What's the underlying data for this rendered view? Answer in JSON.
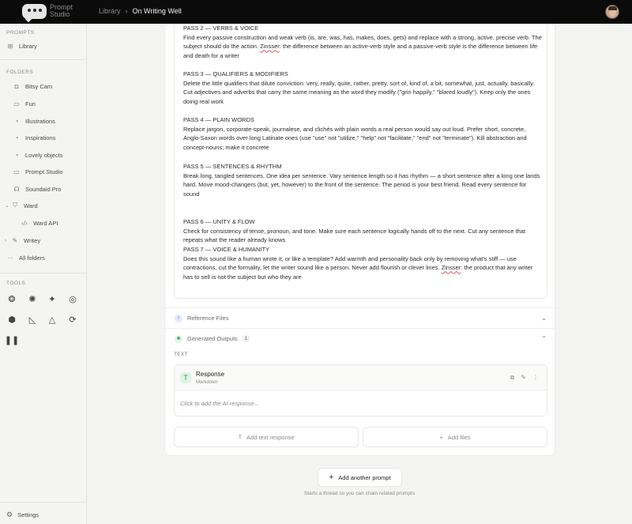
{
  "app": {
    "name_line1": "Prompt",
    "name_line2": "Studio"
  },
  "breadcrumb": {
    "root": "Library",
    "separator": "›",
    "current": "On Writing Well"
  },
  "sidebar": {
    "prompts_label": "PROMPTS",
    "library": "Library",
    "folders_label": "FOLDERS",
    "folders": [
      "Bitsy Cam",
      "Fun",
      "Illustrations",
      "Inspirations",
      "Lovely objects",
      "Prompt Studio",
      "Soundaid Pro",
      "Ward",
      "Ward API",
      "Writey",
      "All folders"
    ],
    "tools_label": "TOOLS",
    "settings": "Settings"
  },
  "prompt": {
    "passes": [
      {
        "heading": "PASS 2 — VERBS & VOICE",
        "body_pre": "Find every passive construction and weak verb (is, are, was, has, makes, does, gets) and replace with a strong, active, precise verb. The subject should do the action. ",
        "spell": "Zinsser",
        "body_post": ": the difference between an active-verb style and a passive-verb style is the difference between life and death for a writer"
      },
      {
        "heading": "PASS 3 — QUALIFIERS & MODIFIERS",
        "body_pre": "Delete the little qualifiers that dilute conviction: very, really, quite, rather, pretty, sort of, kind of, a bit, somewhat, just, actually, basically. Cut adjectives and adverbs that carry the same meaning as the word they modify (\"grin happily,\" \"blared loudly\"). Keep only the ones doing real work",
        "spell": "",
        "body_post": ""
      },
      {
        "heading": "PASS 4 — PLAIN WORDS",
        "body_pre": "Replace jargon, corporate-speak, journalese, and clichés with plain words a real person would say out loud. Prefer short, concrete, Anglo-Saxon words over long Latinate ones (use \"use\" not \"utilize,\" \"help\" not \"facilitate,\" \"end\" not \"terminate\"). Kill abstraction and concept-nouns; make it concrete",
        "spell": "",
        "body_post": ""
      },
      {
        "heading": "PASS 5 — SENTENCES & RHYTHM",
        "body_pre": "Break long, tangled sentences. One idea per sentence. Vary sentence length so it has rhythm — a short sentence after a long one lands hard. Move mood-changers (but, yet, however) to the front of the sentence. The period is your best friend. Read every sentence for sound",
        "spell": "",
        "body_post": ""
      },
      {
        "heading": "PASS 6 — UNITY & FLOW",
        "body_pre": "Check for consistency of tense, pronoun, and tone. Make sure each sentence logically hands off to the next. Cut any sentence that repeats what the reader already knows",
        "spell": "",
        "body_post": ""
      },
      {
        "heading": "PASS 7 — VOICE & HUMANITY",
        "body_pre": "Does this sound like a human wrote it, or like a template? Add warmth and personality back only by removing what's stiff — use contractions, cut the formality, let the writer sound like a person. Never add flourish or clever lines. ",
        "spell": "Zinsser",
        "body_post": ": the product that any writer has to sell is not the subject but who they are"
      }
    ]
  },
  "reference_files": {
    "label": "Reference Files"
  },
  "outputs": {
    "label": "Generated Outputs",
    "count": "1",
    "text_label": "TEXT",
    "response_title": "Response",
    "response_format": "Markdown",
    "placeholder": "Click to add the AI response..."
  },
  "actions": {
    "add_text": "Add text response",
    "add_files": "Add files",
    "add_prompt": "Add another prompt",
    "add_prompt_hint": "Starts a thread so you can chain related prompts"
  },
  "colors": {
    "topbar": "#0b0b0b",
    "accent_green": "#3b9a5a",
    "reference_icon": "#5b7de0"
  }
}
